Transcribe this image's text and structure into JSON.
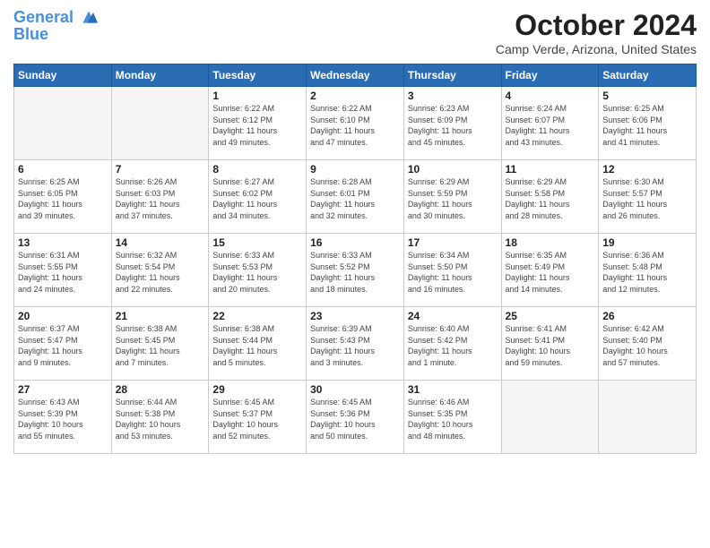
{
  "header": {
    "logo_line1": "General",
    "logo_line2": "Blue",
    "title": "October 2024",
    "location": "Camp Verde, Arizona, United States"
  },
  "days_of_week": [
    "Sunday",
    "Monday",
    "Tuesday",
    "Wednesday",
    "Thursday",
    "Friday",
    "Saturday"
  ],
  "weeks": [
    [
      {
        "day": "",
        "detail": ""
      },
      {
        "day": "",
        "detail": ""
      },
      {
        "day": "1",
        "detail": "Sunrise: 6:22 AM\nSunset: 6:12 PM\nDaylight: 11 hours\nand 49 minutes."
      },
      {
        "day": "2",
        "detail": "Sunrise: 6:22 AM\nSunset: 6:10 PM\nDaylight: 11 hours\nand 47 minutes."
      },
      {
        "day": "3",
        "detail": "Sunrise: 6:23 AM\nSunset: 6:09 PM\nDaylight: 11 hours\nand 45 minutes."
      },
      {
        "day": "4",
        "detail": "Sunrise: 6:24 AM\nSunset: 6:07 PM\nDaylight: 11 hours\nand 43 minutes."
      },
      {
        "day": "5",
        "detail": "Sunrise: 6:25 AM\nSunset: 6:06 PM\nDaylight: 11 hours\nand 41 minutes."
      }
    ],
    [
      {
        "day": "6",
        "detail": "Sunrise: 6:25 AM\nSunset: 6:05 PM\nDaylight: 11 hours\nand 39 minutes."
      },
      {
        "day": "7",
        "detail": "Sunrise: 6:26 AM\nSunset: 6:03 PM\nDaylight: 11 hours\nand 37 minutes."
      },
      {
        "day": "8",
        "detail": "Sunrise: 6:27 AM\nSunset: 6:02 PM\nDaylight: 11 hours\nand 34 minutes."
      },
      {
        "day": "9",
        "detail": "Sunrise: 6:28 AM\nSunset: 6:01 PM\nDaylight: 11 hours\nand 32 minutes."
      },
      {
        "day": "10",
        "detail": "Sunrise: 6:29 AM\nSunset: 5:59 PM\nDaylight: 11 hours\nand 30 minutes."
      },
      {
        "day": "11",
        "detail": "Sunrise: 6:29 AM\nSunset: 5:58 PM\nDaylight: 11 hours\nand 28 minutes."
      },
      {
        "day": "12",
        "detail": "Sunrise: 6:30 AM\nSunset: 5:57 PM\nDaylight: 11 hours\nand 26 minutes."
      }
    ],
    [
      {
        "day": "13",
        "detail": "Sunrise: 6:31 AM\nSunset: 5:55 PM\nDaylight: 11 hours\nand 24 minutes."
      },
      {
        "day": "14",
        "detail": "Sunrise: 6:32 AM\nSunset: 5:54 PM\nDaylight: 11 hours\nand 22 minutes."
      },
      {
        "day": "15",
        "detail": "Sunrise: 6:33 AM\nSunset: 5:53 PM\nDaylight: 11 hours\nand 20 minutes."
      },
      {
        "day": "16",
        "detail": "Sunrise: 6:33 AM\nSunset: 5:52 PM\nDaylight: 11 hours\nand 18 minutes."
      },
      {
        "day": "17",
        "detail": "Sunrise: 6:34 AM\nSunset: 5:50 PM\nDaylight: 11 hours\nand 16 minutes."
      },
      {
        "day": "18",
        "detail": "Sunrise: 6:35 AM\nSunset: 5:49 PM\nDaylight: 11 hours\nand 14 minutes."
      },
      {
        "day": "19",
        "detail": "Sunrise: 6:36 AM\nSunset: 5:48 PM\nDaylight: 11 hours\nand 12 minutes."
      }
    ],
    [
      {
        "day": "20",
        "detail": "Sunrise: 6:37 AM\nSunset: 5:47 PM\nDaylight: 11 hours\nand 9 minutes."
      },
      {
        "day": "21",
        "detail": "Sunrise: 6:38 AM\nSunset: 5:45 PM\nDaylight: 11 hours\nand 7 minutes."
      },
      {
        "day": "22",
        "detail": "Sunrise: 6:38 AM\nSunset: 5:44 PM\nDaylight: 11 hours\nand 5 minutes."
      },
      {
        "day": "23",
        "detail": "Sunrise: 6:39 AM\nSunset: 5:43 PM\nDaylight: 11 hours\nand 3 minutes."
      },
      {
        "day": "24",
        "detail": "Sunrise: 6:40 AM\nSunset: 5:42 PM\nDaylight: 11 hours\nand 1 minute."
      },
      {
        "day": "25",
        "detail": "Sunrise: 6:41 AM\nSunset: 5:41 PM\nDaylight: 10 hours\nand 59 minutes."
      },
      {
        "day": "26",
        "detail": "Sunrise: 6:42 AM\nSunset: 5:40 PM\nDaylight: 10 hours\nand 57 minutes."
      }
    ],
    [
      {
        "day": "27",
        "detail": "Sunrise: 6:43 AM\nSunset: 5:39 PM\nDaylight: 10 hours\nand 55 minutes."
      },
      {
        "day": "28",
        "detail": "Sunrise: 6:44 AM\nSunset: 5:38 PM\nDaylight: 10 hours\nand 53 minutes."
      },
      {
        "day": "29",
        "detail": "Sunrise: 6:45 AM\nSunset: 5:37 PM\nDaylight: 10 hours\nand 52 minutes."
      },
      {
        "day": "30",
        "detail": "Sunrise: 6:45 AM\nSunset: 5:36 PM\nDaylight: 10 hours\nand 50 minutes."
      },
      {
        "day": "31",
        "detail": "Sunrise: 6:46 AM\nSunset: 5:35 PM\nDaylight: 10 hours\nand 48 minutes."
      },
      {
        "day": "",
        "detail": ""
      },
      {
        "day": "",
        "detail": ""
      }
    ]
  ]
}
